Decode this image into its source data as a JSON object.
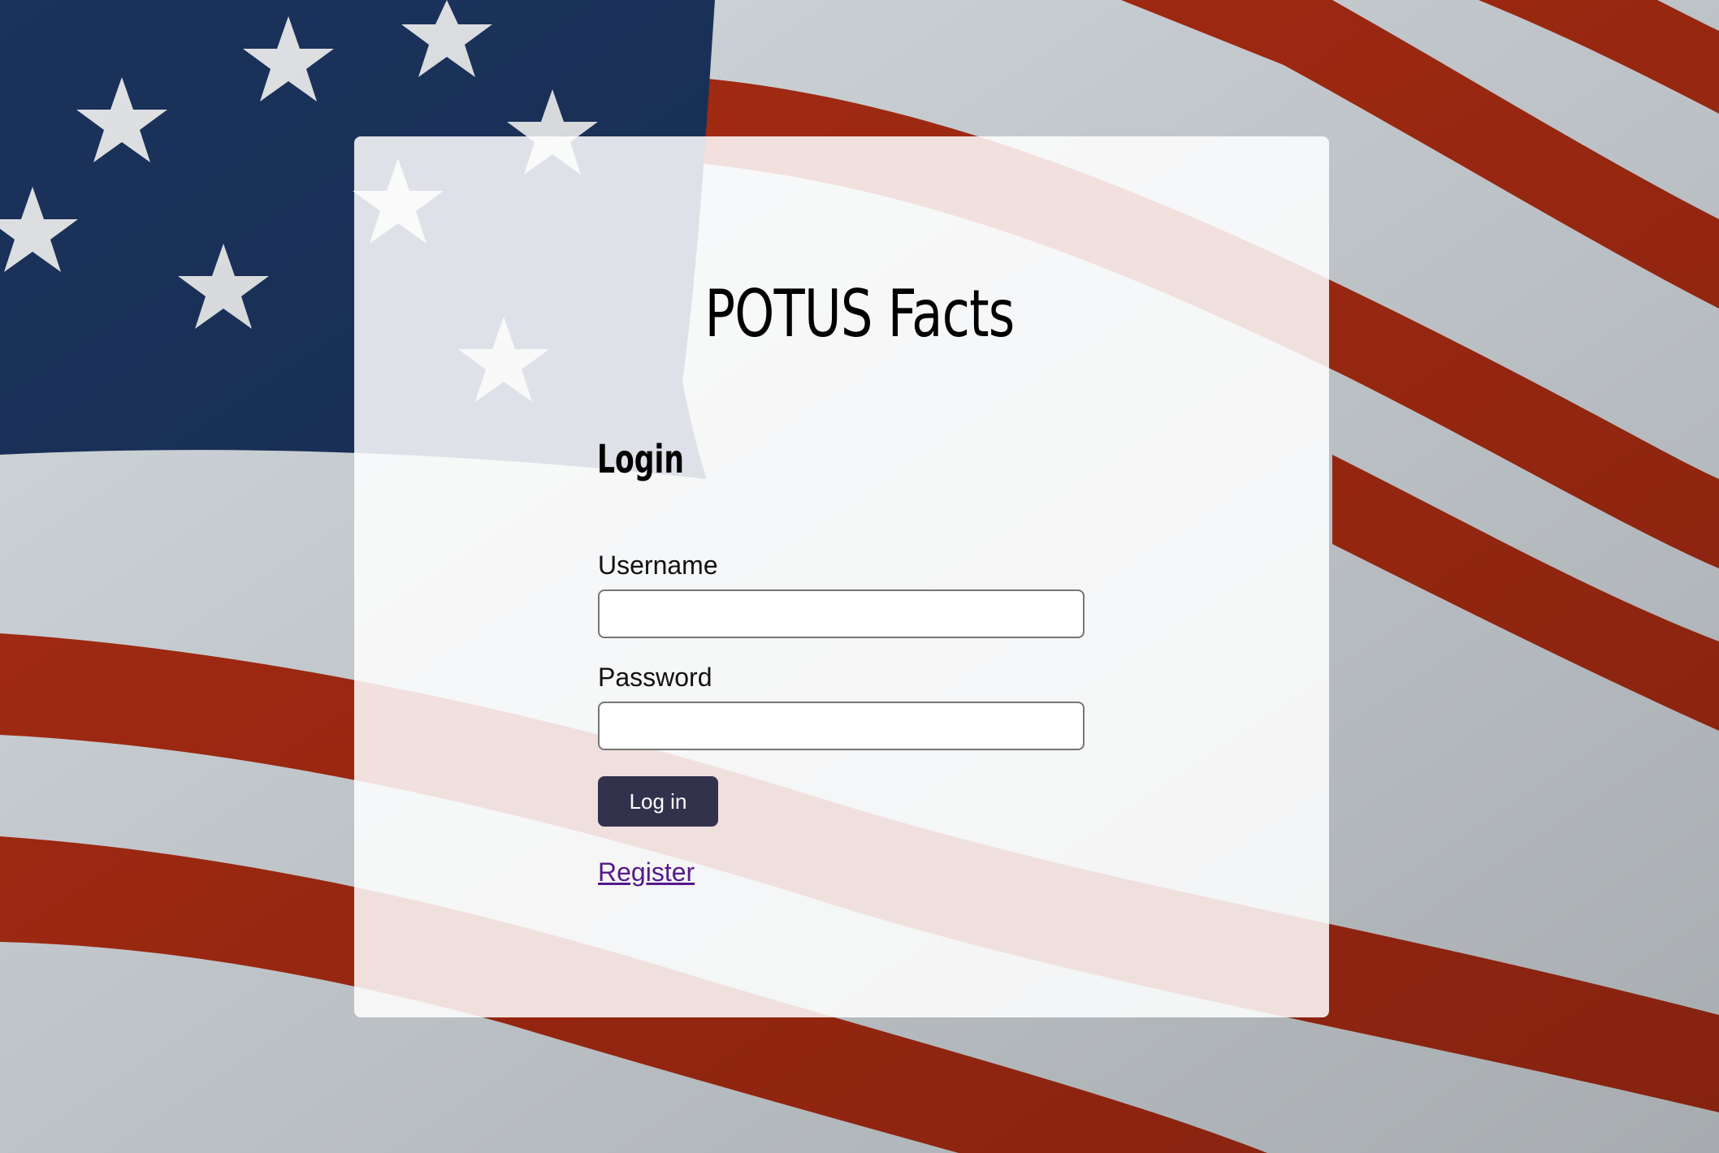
{
  "site": {
    "title": "POTUS Facts"
  },
  "login_form": {
    "heading": "Login",
    "username_label": "Username",
    "username_value": "",
    "password_label": "Password",
    "password_value": "",
    "submit_label": "Log in",
    "register_link": "Register"
  },
  "background": {
    "image": "american-flag",
    "colors": {
      "canton_blue": "#1c3560",
      "stripe_red": "#b22e14",
      "stripe_white": "#dfe5ea"
    }
  },
  "colors": {
    "button_bg": "#33324d",
    "button_text": "#ffffff",
    "link": "#551a8b",
    "card_bg": "#ffffff"
  }
}
